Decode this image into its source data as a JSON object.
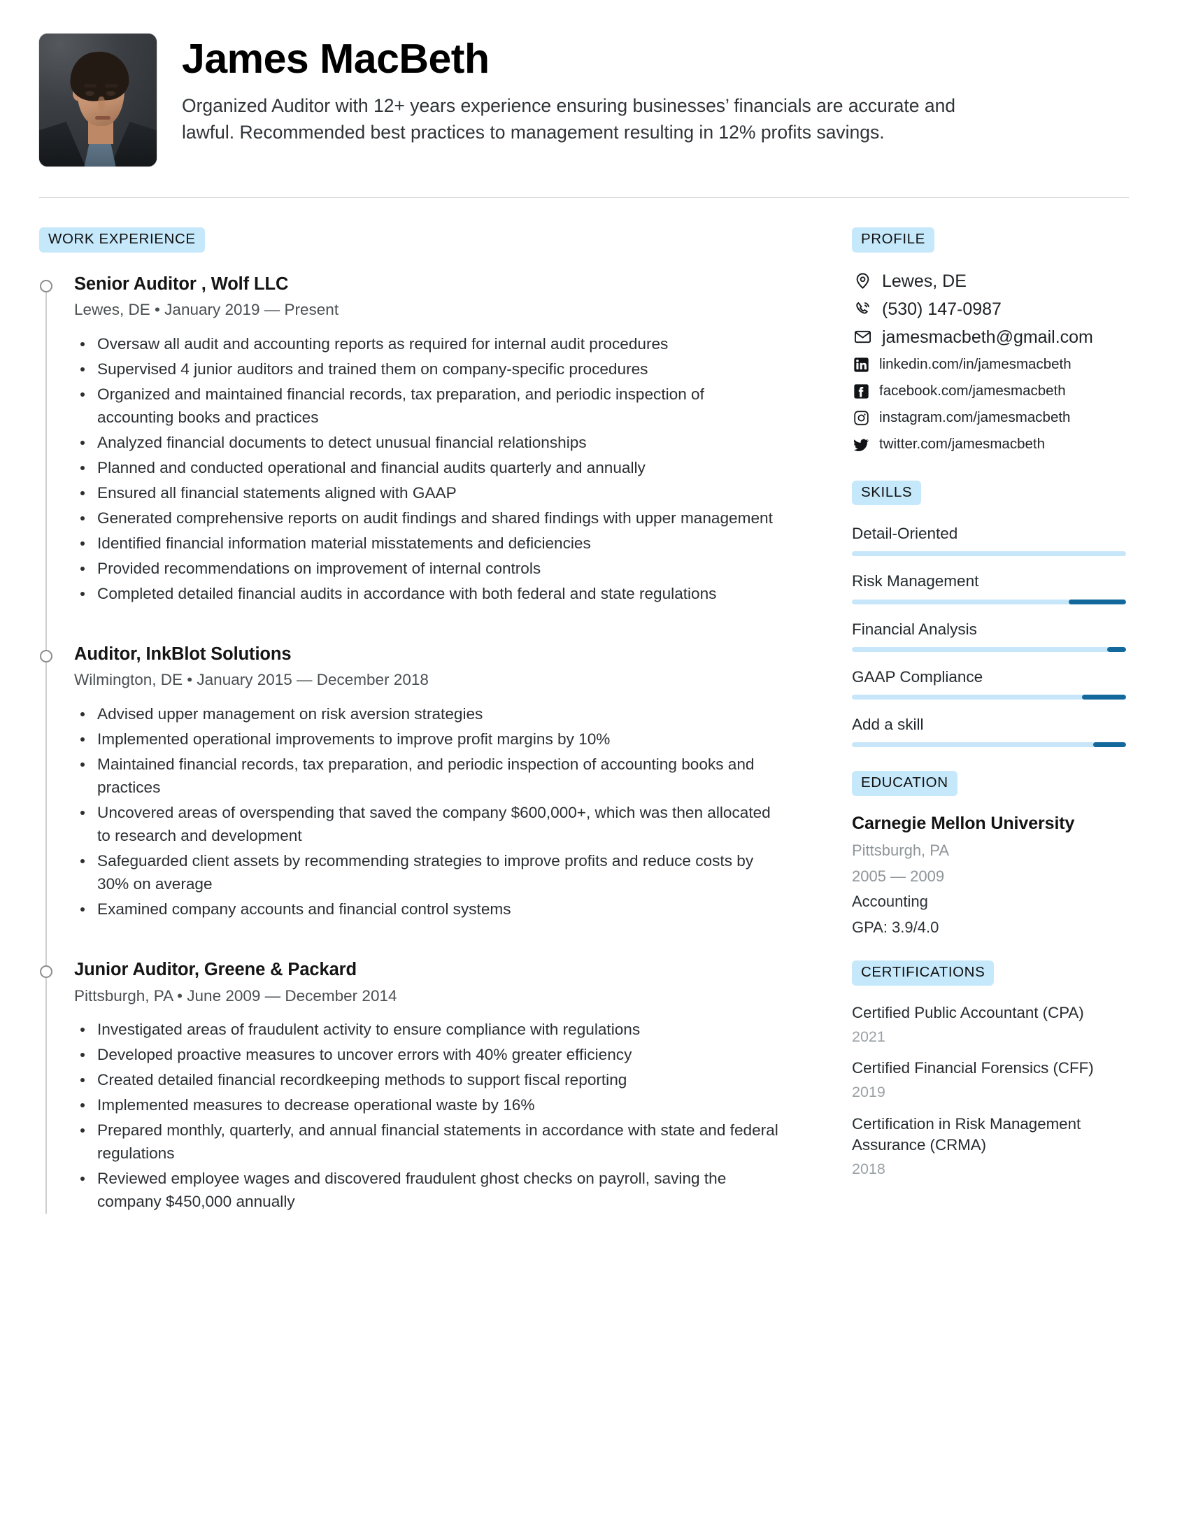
{
  "header": {
    "name": "James MacBeth",
    "summary": "Organized Auditor with 12+ years experience ensuring businesses’ financials are accurate and lawful. Recommended best practices to management resulting in 12% profits savings.",
    "avatar_alt": "profile-photo"
  },
  "work": {
    "section_label": "WORK EXPERIENCE",
    "jobs": [
      {
        "title": "Senior Auditor , Wolf LLC",
        "meta": "Lewes, DE • January 2019 — Present",
        "bullets": [
          "Oversaw all audit and accounting reports as required for internal audit procedures",
          "Supervised 4 junior auditors and trained them on company-specific procedures",
          "Organized and maintained financial records, tax preparation, and periodic inspection of accounting books and practices",
          "Analyzed financial documents to detect unusual financial relationships",
          "Planned and conducted  operational and financial audits quarterly and annually",
          "Ensured all financial statements aligned with GAAP",
          "Generated comprehensive reports on audit findings and shared findings with upper management",
          "Identified financial information material misstatements and deficiencies",
          "Provided recommendations on improvement of internal controls",
          "Completed detailed financial audits in accordance with both federal and state regulations"
        ]
      },
      {
        "title": "Auditor, InkBlot Solutions",
        "meta": "Wilmington, DE • January 2015 — December 2018",
        "bullets": [
          "Advised upper management on risk aversion strategies",
          "Implemented operational improvements to improve profit margins by 10%",
          "Maintained financial records, tax preparation, and periodic inspection of accounting books and practices",
          "Uncovered areas of overspending that saved the company $600,000+, which was then allocated to research and development",
          "Safeguarded client assets by recommending strategies to improve profits and reduce costs by 30% on average",
          "Examined company accounts and financial control systems"
        ]
      },
      {
        "title": "Junior Auditor, Greene & Packard",
        "meta": "Pittsburgh, PA • June 2009 — December 2014",
        "bullets": [
          "Investigated areas of fraudulent activity to ensure compliance with regulations",
          "Developed proactive measures to uncover errors with 40% greater efficiency",
          "Created detailed financial recordkeeping methods to support fiscal reporting",
          "Implemented measures to decrease operational waste by 16%",
          "Prepared monthly, quarterly, and annual financial statements in accordance with state and federal regulations",
          "Reviewed employee wages and discovered fraudulent ghost checks on payroll, saving the company $450,000 annually"
        ]
      }
    ]
  },
  "profile": {
    "section_label": "PROFILE",
    "items": [
      {
        "icon": "location-pin-icon",
        "text": "Lewes, DE",
        "size": "big"
      },
      {
        "icon": "phone-icon",
        "text": "(530) 147-0987",
        "size": "big"
      },
      {
        "icon": "envelope-icon",
        "text": "jamesmacbeth@gmail.com",
        "size": "big"
      },
      {
        "icon": "linkedin-icon",
        "text": "linkedin.com/in/jamesmacbeth",
        "size": "sm"
      },
      {
        "icon": "facebook-icon",
        "text": "facebook.com/jamesmacbeth",
        "size": "sm"
      },
      {
        "icon": "instagram-icon",
        "text": "instagram.com/jamesmacbeth",
        "size": "sm"
      },
      {
        "icon": "twitter-icon",
        "text": "twitter.com/jamesmacbeth",
        "size": "sm"
      }
    ]
  },
  "skills": {
    "section_label": "SKILLS",
    "items": [
      {
        "name": "Detail-Oriented",
        "level": 0
      },
      {
        "name": "Risk Management",
        "level": 21
      },
      {
        "name": "Financial Analysis",
        "level": 7
      },
      {
        "name": "GAAP Compliance",
        "level": 16
      },
      {
        "name": "Add a skill",
        "level": 12
      }
    ],
    "track_color": "#c7e6fa",
    "fill_color": "#14699c"
  },
  "education": {
    "section_label": "EDUCATION",
    "school": "Carnegie Mellon University",
    "location": "Pittsburgh, PA",
    "years": "2005 — 2009",
    "major": "Accounting",
    "gpa": "GPA: 3.9/4.0"
  },
  "certifications": {
    "section_label": "CERTIFICATIONS",
    "items": [
      {
        "name": "Certified Public Accountant (CPA)",
        "year": "2021"
      },
      {
        "name": "Certified Financial Forensics (CFF)",
        "year": "2019"
      },
      {
        "name": "Certification in Risk Management Assurance (CRMA)",
        "year": "2018"
      }
    ]
  },
  "theme": {
    "badge_bg": "#c5e8fa",
    "accent": "#14699c",
    "divider": "#d4d4d4"
  }
}
